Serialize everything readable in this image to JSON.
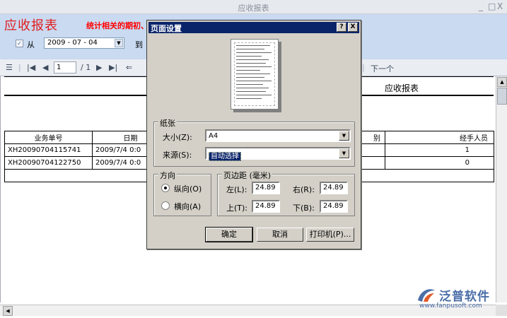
{
  "window": {
    "title": "应收报表",
    "controls": [
      "_",
      "□",
      "X"
    ]
  },
  "header": {
    "title": "应收报表",
    "subtitle": "统计相关的期初、",
    "from_label": "从",
    "date_value": "2009 - 07 - 04",
    "to_label": "到"
  },
  "toolbar": {
    "page_value": "1",
    "page_total": "/ 1",
    "next_label": "下一个"
  },
  "report": {
    "title": "应收报表",
    "columns": [
      "业务单号",
      "日期",
      "别",
      "经手人员"
    ],
    "rows": [
      [
        "XH200907041​15741",
        "2009/7/4 0:0",
        "",
        "1"
      ],
      [
        "XH200907041​22750",
        "2009/7/4 0:0",
        "",
        "0"
      ]
    ]
  },
  "brand": {
    "name": "泛普软件",
    "url": "www.fanpusoft.com"
  },
  "dialog": {
    "title": "页面设置",
    "help_btn": "?",
    "close_btn": "X",
    "paper_group": "纸张",
    "size_label": "大小(Z):",
    "size_value": "A4",
    "source_label": "来源(S):",
    "source_value": "自动选择",
    "orientation_group": "方向",
    "portrait_label": "纵向(O)",
    "landscape_label": "横向(A)",
    "margins_group": "页边距 (毫米)",
    "left_label": "左(L):",
    "left_value": "24.89",
    "right_label": "右(R):",
    "right_value": "24.89",
    "top_label": "上(T):",
    "top_value": "24.89",
    "bottom_label": "下(B):",
    "bottom_value": "24.89",
    "ok_label": "确定",
    "cancel_label": "取消",
    "printer_label": "打印机(P)..."
  }
}
